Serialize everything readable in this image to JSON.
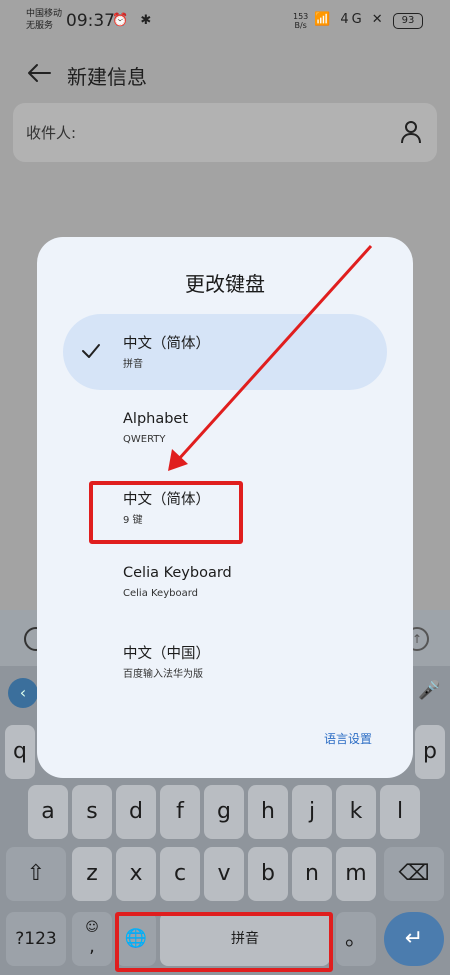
{
  "status_bar": {
    "carrier_line1": "中国移动",
    "carrier_line2": "无服务",
    "time": "09:37",
    "left_icons": "⏰ ✱",
    "net_speed_value": "153",
    "net_speed_unit": "B/s",
    "right_icons": "📶 4G ✕",
    "battery": "93"
  },
  "header": {
    "title": "新建信息"
  },
  "recipient": {
    "label": "收件人:"
  },
  "dialog": {
    "title": "更改键盘",
    "options": [
      {
        "name": "中文（简体）",
        "sub": "拼音",
        "selected": true
      },
      {
        "name": "Alphabet",
        "sub": "QWERTY",
        "selected": false
      },
      {
        "name": "中文（简体）",
        "sub": "9 键",
        "selected": false
      },
      {
        "name": "Celia Keyboard",
        "sub": "Celia Keyboard",
        "selected": false
      },
      {
        "name": "中文（中国）",
        "sub": "百度输入法华为版",
        "selected": false
      }
    ],
    "language_settings": "语言设置"
  },
  "keyboard": {
    "row1_left": "q",
    "row1_right": "p",
    "row2": [
      "a",
      "s",
      "d",
      "f",
      "g",
      "h",
      "j",
      "k",
      "l"
    ],
    "row3": [
      "z",
      "x",
      "c",
      "v",
      "b",
      "n",
      "m"
    ],
    "sym_key": "?123",
    "comma_key": ",",
    "space_key": "拼音",
    "period_key": "。",
    "emoji_glyph": "☺",
    "enter_glyph": "↵",
    "shift_glyph": "⇧",
    "delete_glyph": "⌫",
    "globe_glyph": "🌐",
    "back_glyph": "‹",
    "mic_glyph": "🎤",
    "up_glyph": "↑"
  },
  "colors": {
    "annotation_red": "#e01e1e",
    "link_blue": "#2b6cc4",
    "selected_bg": "#d6e4f7"
  }
}
